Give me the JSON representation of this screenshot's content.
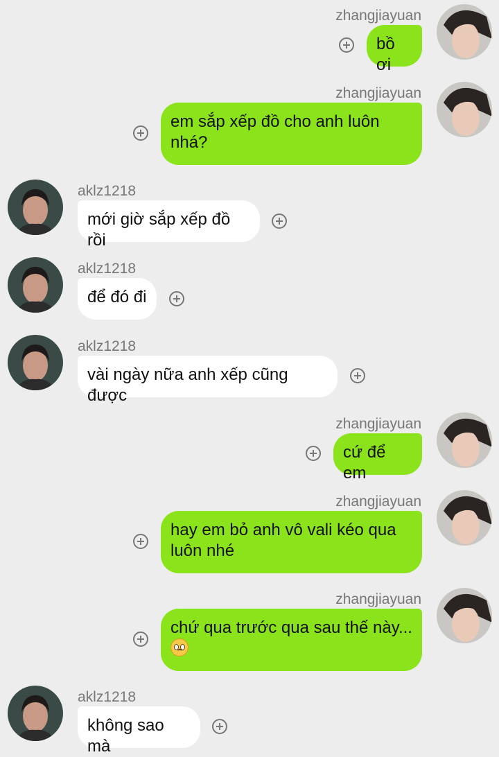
{
  "me": {
    "username": "zhangjiayuan"
  },
  "other": {
    "username": "aklz1218"
  },
  "messages": [
    {
      "sender": "me",
      "text": "bồ ơi"
    },
    {
      "sender": "me",
      "text": "em sắp xếp đồ cho anh luôn nhá?"
    },
    {
      "sender": "other",
      "text": "mới giờ sắp xếp đồ rồi"
    },
    {
      "sender": "other",
      "text": "để đó đi"
    },
    {
      "sender": "other",
      "text": "vài ngày nữa anh xếp cũng được"
    },
    {
      "sender": "me",
      "text": "cứ để em"
    },
    {
      "sender": "me",
      "text": "hay em bỏ anh vô vali kéo qua luôn nhé"
    },
    {
      "sender": "me",
      "text": "chứ qua trước qua sau thế này...",
      "emoji": "pleading-face-emoji"
    },
    {
      "sender": "other",
      "text": "không sao mà"
    }
  ],
  "colors": {
    "background": "#ededed",
    "my_bubble": "#8be31c",
    "other_bubble": "#ffffff",
    "username": "#777777"
  }
}
